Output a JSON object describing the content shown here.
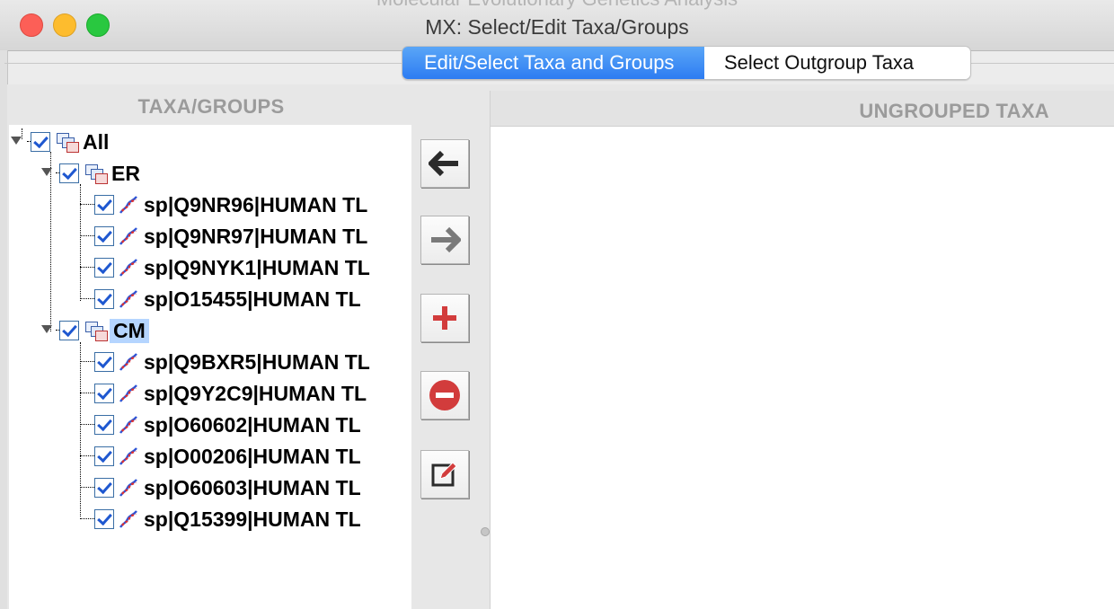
{
  "window": {
    "background_title": "Molecular Evolutionary Genetics Analysis",
    "title": "MX: Select/Edit Taxa/Groups"
  },
  "tabs": [
    {
      "label": "Edit/Select Taxa and Groups",
      "active": true
    },
    {
      "label": "Select Outgroup Taxa",
      "active": false
    }
  ],
  "left_panel": {
    "header": "TAXA/GROUPS",
    "tree": {
      "root": {
        "label": "All",
        "checked": true
      },
      "groups": [
        {
          "label": "ER",
          "checked": true,
          "selected": false,
          "taxa": [
            "sp|Q9NR96|HUMAN TL",
            "sp|Q9NR97|HUMAN TL",
            "sp|Q9NYK1|HUMAN TL",
            "sp|O15455|HUMAN TL"
          ]
        },
        {
          "label": "CM",
          "checked": true,
          "selected": true,
          "taxa": [
            "sp|Q9BXR5|HUMAN TL",
            "sp|Q9Y2C9|HUMAN TL",
            "sp|O60602|HUMAN TL",
            "sp|O00206|HUMAN TL",
            "sp|O60603|HUMAN TL",
            "sp|Q15399|HUMAN TL"
          ]
        }
      ]
    }
  },
  "toolbar": {
    "buttons": [
      {
        "icon": "arrow-left-icon"
      },
      {
        "icon": "arrow-right-icon"
      },
      {
        "icon": "plus-icon"
      },
      {
        "icon": "minus-circle-icon"
      },
      {
        "icon": "edit-icon"
      }
    ]
  },
  "right_panel": {
    "header": "UNGROUPED TAXA",
    "items": []
  },
  "colors": {
    "accent_tab": "#2d7cf2",
    "selection": "#b5d5ff",
    "checkbox_check": "#1f58d0",
    "add_red": "#d23c3c"
  }
}
